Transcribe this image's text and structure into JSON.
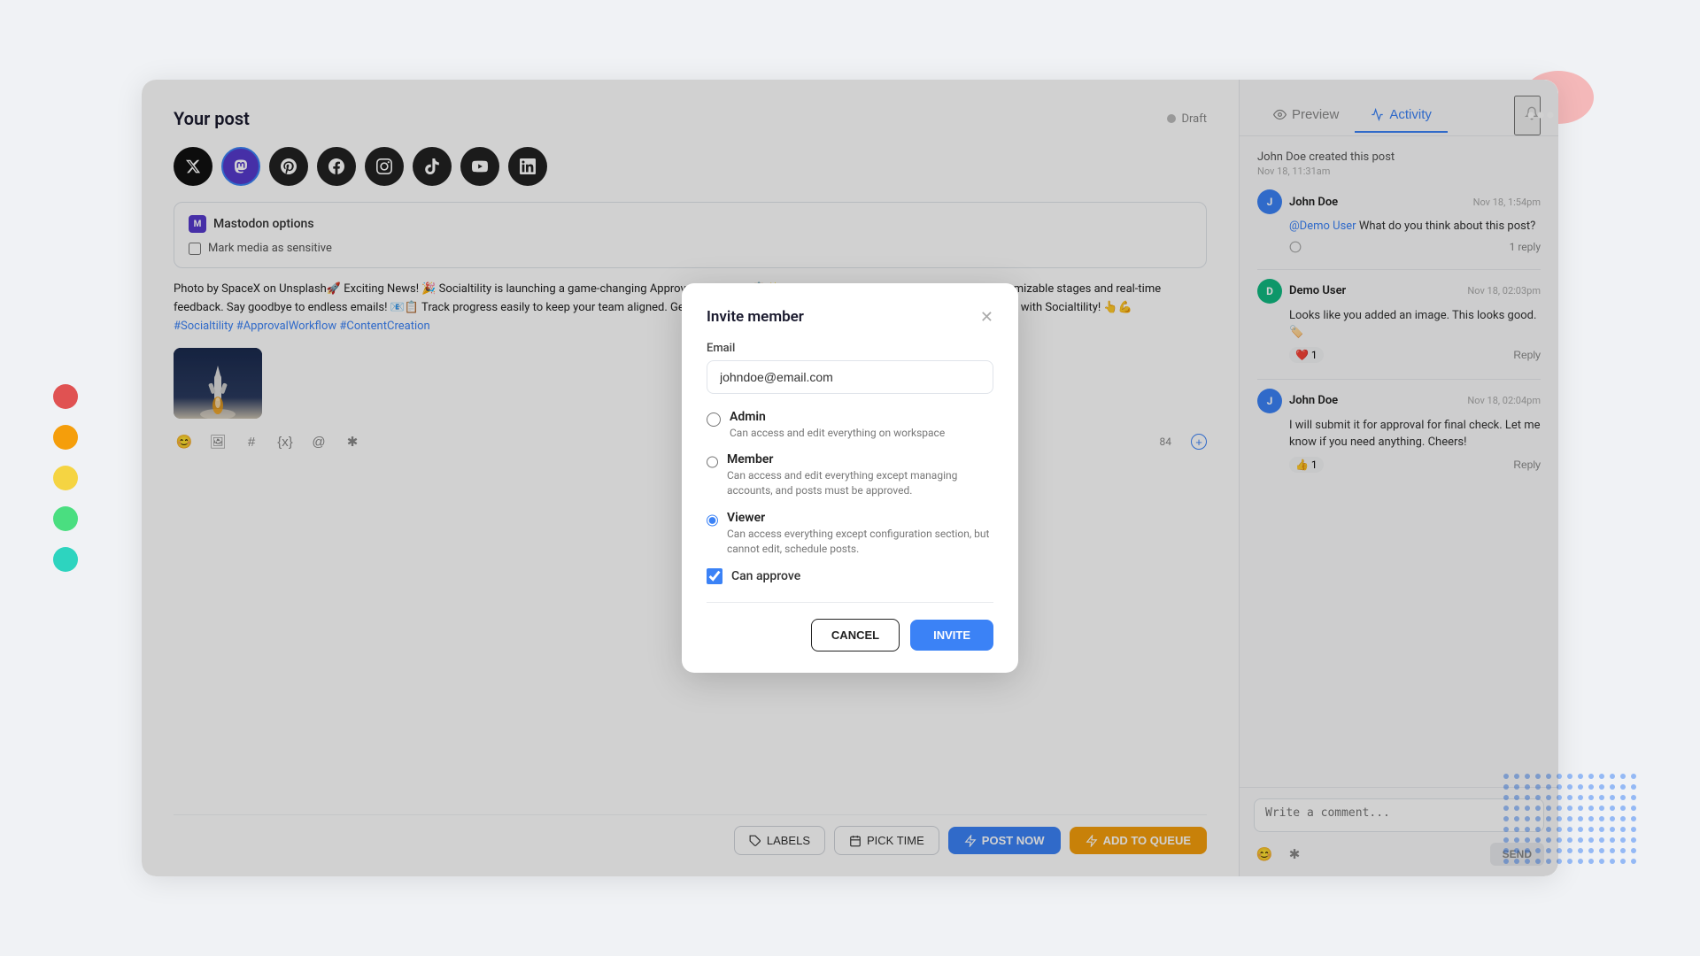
{
  "app": {
    "title": "Socialtility"
  },
  "color_dots": [
    "#e05252",
    "#f59e0b",
    "#f5d442",
    "#4ade80",
    "#2dd4bf"
  ],
  "post": {
    "title": "Your post",
    "status": "Draft",
    "content": "Photo by SpaceX on Unsplash🚀 Exciting News! 🎉 Socialtility is launching a game-changing Approval Workflow! 📋✨ Streamline your content approvals with customizable stages and real-time feedback. Say goodbye to endless emails! 📧📋 Track progress easily to keep your team aligned. Get ready to enhance your content strategy and boost your creativity with Socialtility! 👆💪",
    "hashtags": "#Socialtility #ApprovalWorkflow #ContentCreation",
    "mastodon_label": "Mastodon options",
    "media_sensitive_label": "Mark media as sensitive",
    "char_count": "84",
    "toolbar": {
      "labels_btn": "LABELS",
      "pick_time_btn": "PICK TIME",
      "post_now_btn": "POST NOW",
      "add_queue_btn": "ADD TO QUEUE"
    }
  },
  "social_icons": [
    {
      "id": "twitter-x",
      "symbol": "𝕏",
      "active": false
    },
    {
      "id": "mastodon",
      "symbol": "M",
      "active": true,
      "color": "#563acc"
    },
    {
      "id": "pinterest",
      "symbol": "P",
      "active": false
    },
    {
      "id": "facebook",
      "symbol": "f",
      "active": false
    },
    {
      "id": "instagram",
      "symbol": "◎",
      "active": false
    },
    {
      "id": "tiktok",
      "symbol": "♪",
      "active": false
    },
    {
      "id": "youtube",
      "symbol": "▶",
      "active": false
    },
    {
      "id": "linkedin",
      "symbol": "in",
      "active": false
    }
  ],
  "right_panel": {
    "tab_preview": "Preview",
    "tab_activity": "Activity",
    "created_text": "John Doe created this post",
    "created_time": "Nov 18, 11:31am",
    "comments": [
      {
        "author": "John Doe",
        "avatar_initial": "J",
        "avatar_color": "blue",
        "time": "Nov 18, 1:54pm",
        "mention": "@Demo User",
        "text": "What do you think about this post?",
        "reply_count": "1 reply",
        "reactions": []
      },
      {
        "author": "Demo User",
        "avatar_initial": "D",
        "avatar_color": "green",
        "time": "Nov 18, 02:03pm",
        "mention": "",
        "text": "Looks like you added an image. This looks good. 🏷️",
        "reply_count": "",
        "reactions": [
          "❤️",
          "1"
        ]
      },
      {
        "author": "John Doe",
        "avatar_initial": "J",
        "avatar_color": "blue",
        "time": "Nov 18, 02:04pm",
        "mention": "",
        "text": "I will submit it for approval for final check. Let me know if you need anything. Cheers!",
        "reply_count": "",
        "reactions": [
          "👍",
          "1"
        ]
      }
    ],
    "comment_placeholder": "Write a comment...",
    "send_btn": "SEND"
  },
  "modal": {
    "title": "Invite member",
    "email_label": "Email",
    "email_value": "johndoe@email.com",
    "roles": [
      {
        "id": "admin",
        "name": "Admin",
        "description": "Can access and edit everything on workspace",
        "selected": false
      },
      {
        "id": "member",
        "name": "Member",
        "description": "Can access and edit everything except managing accounts, and posts must be approved.",
        "selected": false
      },
      {
        "id": "viewer",
        "name": "Viewer",
        "description": "Can access everything except configuration section, but cannot edit, schedule posts.",
        "selected": true
      }
    ],
    "can_approve_label": "Can approve",
    "can_approve_checked": true,
    "cancel_btn": "CANCEL",
    "invite_btn": "INVITE"
  }
}
